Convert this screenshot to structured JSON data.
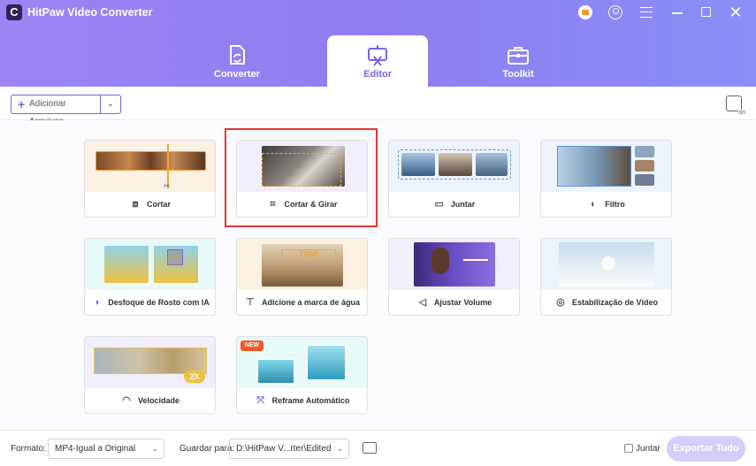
{
  "window": {
    "title": "HitPaw Video Converter",
    "logo_letter": "C",
    "icons": [
      "cart-icon",
      "user-icon",
      "menu-icon",
      "minimize-icon",
      "maximize-icon",
      "close-icon"
    ]
  },
  "tabs": [
    {
      "label": "Converter",
      "icon": "converter-icon",
      "active": false
    },
    {
      "label": "Editor",
      "icon": "editor-icon",
      "active": true
    },
    {
      "label": "Toolkit",
      "icon": "toolkit-icon",
      "active": false
    }
  ],
  "toolbar": {
    "add_files_label": "Adicionar Arquivos",
    "dropdown_icon": "chevron-down-icon",
    "hardware_icon": "hardware-acceleration-icon"
  },
  "tools": [
    {
      "label": "Cortar",
      "icon": "split-icon"
    },
    {
      "label": "Cortar & Girar",
      "icon": "crop-icon",
      "selected": true
    },
    {
      "label": "Juntar",
      "icon": "merge-icon"
    },
    {
      "label": "Filtro",
      "icon": "filter-icon"
    },
    {
      "label": "Desfoque de Rosto com IA",
      "icon": "face-blur-icon"
    },
    {
      "label": "Adicione a marca de água",
      "icon": "watermark-icon"
    },
    {
      "label": "Ajustar Volume",
      "icon": "volume-icon"
    },
    {
      "label": "Estabilização de Vídeo",
      "icon": "stabilize-icon"
    },
    {
      "label": "Velocidade",
      "icon": "speed-icon"
    },
    {
      "label": "Reframe Automático",
      "icon": "reframe-icon"
    }
  ],
  "thumb_text": {
    "watermark": "TRIP",
    "speed_badge": "2X",
    "new_badge": "NEW"
  },
  "footer": {
    "format_label": "Formato:",
    "format_value": "MP4-Igual a Original",
    "save_label": "Guardar para:",
    "save_path": "D:\\HitPaw V...rter\\Edited",
    "merge_label": "Juntar",
    "export_label": "Exportar Tudo"
  },
  "colors": {
    "accent": "#7b63e6",
    "header_gradient_start": "#9d84f3",
    "header_gradient_end": "#8a8ef5",
    "selection_border": "#e53535",
    "export_disabled": "#d6cdf8"
  }
}
